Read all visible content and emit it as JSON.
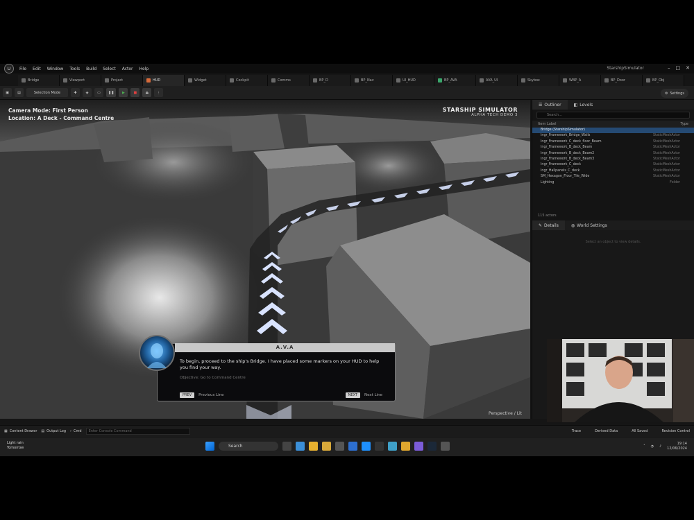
{
  "menubar": {
    "logo": "U",
    "items": [
      "File",
      "Edit",
      "Window",
      "Tools",
      "Build",
      "Select",
      "Actor",
      "Help"
    ],
    "project": "StarshipSimulator"
  },
  "tabs": [
    "Bridge",
    "Viewport",
    "Project",
    "HUD",
    "Widget",
    "Cockpit",
    "Comms",
    "BP_D",
    "BP_Nav",
    "UI_HUD",
    "BP_AVA",
    "AVA_UI",
    "Skybox",
    "WBP_A",
    "BP_Door",
    "BP_Obj"
  ],
  "toolbar": {
    "mode": "Selection Mode",
    "settings": "Settings"
  },
  "hud": {
    "camera_mode": "Camera Mode: First Person",
    "location": "Location: A Deck - Command Centre",
    "title": "STARSHIP SIMULATOR",
    "subtitle": "ALPHA TECH DEMO 3"
  },
  "dialog": {
    "speaker": "A.V.A",
    "text": "To begin, proceed to the ship's Bridge. I have placed some markers on your HUD to help you find your way.",
    "hint": "Objective: Go to Command Centre",
    "prev_key": "PREV",
    "prev_label": "Previous Line",
    "next_key": "NEXT",
    "next_label": "Next Line"
  },
  "viewport_tag": "Perspective / Lit",
  "outliner": {
    "tabs": [
      "Outliner",
      "Levels"
    ],
    "search_placeholder": "Search...",
    "col_label": "Item Label",
    "col_type": "Type",
    "rows": [
      {
        "label": "Bridge (StarshipSimulator)",
        "type": "",
        "sel": true
      },
      {
        "label": "Ingr_Framework_Bridge_Walls",
        "type": "StaticMeshActor"
      },
      {
        "label": "Ingr_Framework_C_deck_floor_Beam",
        "type": "StaticMeshActor"
      },
      {
        "label": "Ingr_Framework_B_deck_Beam",
        "type": "StaticMeshActor"
      },
      {
        "label": "Ingr_Framework_B_deck_Beam2",
        "type": "StaticMeshActor"
      },
      {
        "label": "Ingr_Framework_B_deck_Beam3",
        "type": "StaticMeshActor"
      },
      {
        "label": "Ingr_Framework_C_deck",
        "type": "StaticMeshActor"
      },
      {
        "label": "Ingr_Hallpanels_C_deck",
        "type": "StaticMeshActor"
      },
      {
        "label": "SM_Hexagon_Floor_Tile_Wide",
        "type": "StaticMeshActor"
      },
      {
        "label": "Lighting",
        "type": "Folder"
      }
    ],
    "count": "115 actors"
  },
  "details": {
    "tabs": [
      "Details",
      "World Settings"
    ],
    "empty": "Select an object to view details."
  },
  "bottom": {
    "items": [
      "Content Drawer",
      "Output Log",
      "Cmd"
    ],
    "cmd_placeholder": "Enter Console Command",
    "right": [
      "Trace",
      "Derived Data",
      "All Saved",
      "Revision Control"
    ]
  },
  "taskbar": {
    "weather_temp": "Light rain",
    "weather_sub": "Tomorrow",
    "search": "Search",
    "time": "19:14",
    "date": "12/06/2024"
  },
  "colors": {
    "accent": "#254a73",
    "viewport": "#3a3a3a",
    "arrows": "#d9e3ff"
  }
}
